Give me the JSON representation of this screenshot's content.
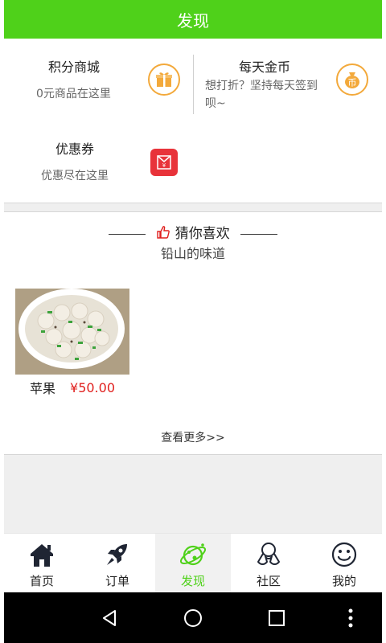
{
  "header": {
    "title": "发现"
  },
  "features": [
    {
      "title": "积分商城",
      "subtitle": "0元商品在这里",
      "icon": "gift-icon"
    },
    {
      "title": "每天金币",
      "subtitle": "想打折？坚持每天签到呗~",
      "icon": "coin-bag-icon",
      "icon_text": "币"
    },
    {
      "title": "优惠券",
      "subtitle": "优惠尽在这里",
      "icon": "coupon-icon",
      "icon_text": "¥"
    }
  ],
  "guess": {
    "title": "猜你喜欢",
    "subtitle": "铅山的味道",
    "product": {
      "name": "苹果",
      "price": "¥50.00"
    },
    "more": "查看更多>>"
  },
  "tabs": [
    {
      "label": "首页",
      "icon": "home-icon",
      "active": false
    },
    {
      "label": "订单",
      "icon": "rocket-icon",
      "active": false
    },
    {
      "label": "发现",
      "icon": "planet-icon",
      "active": true
    },
    {
      "label": "社区",
      "icon": "community-icon",
      "active": false
    },
    {
      "label": "我的",
      "icon": "smiley-icon",
      "active": false
    }
  ],
  "colors": {
    "brand": "#4fd11a",
    "price": "#e0201e",
    "accent_orange": "#f3a93b",
    "coupon_red": "#e8333a"
  }
}
